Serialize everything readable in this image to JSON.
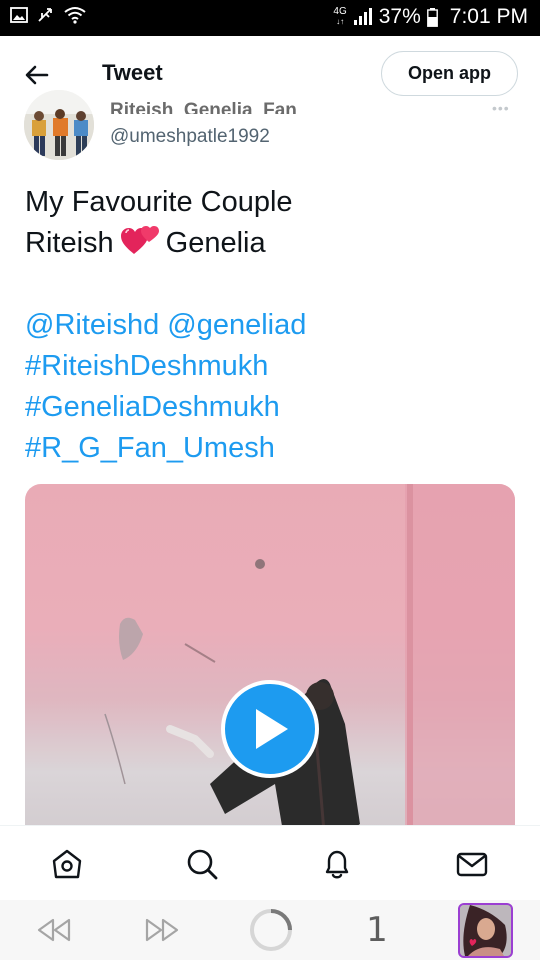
{
  "status_bar": {
    "network_type": "4G",
    "battery": "37%",
    "time": "7:01 PM"
  },
  "header": {
    "title": "Tweet",
    "open_app_label": "Open app"
  },
  "author": {
    "display_name": "Riteish_Genelia_Fan",
    "handle": "@umeshpatle1992"
  },
  "tweet": {
    "line1": "My Favourite Couple",
    "line2_pre": "Riteish",
    "line2_post": "Genelia",
    "mentions": [
      "@Riteishd",
      "@geneliad"
    ],
    "hashtags": [
      "#RiteishDeshmukh",
      "#GeneliaDeshmukh",
      "#R_G_Fan_Umesh"
    ],
    "emoji_name": "two-hearts-emoji"
  },
  "media": {
    "type": "video",
    "play_icon": "play-icon"
  },
  "tabs": [
    "home-icon",
    "search-icon",
    "notifications-icon",
    "messages-icon"
  ],
  "browser": {
    "tab_count": "1"
  },
  "colors": {
    "link": "#1d9bf0",
    "text": "#0f1419",
    "secondary": "#536471",
    "play_button": "#1d9bf0"
  }
}
